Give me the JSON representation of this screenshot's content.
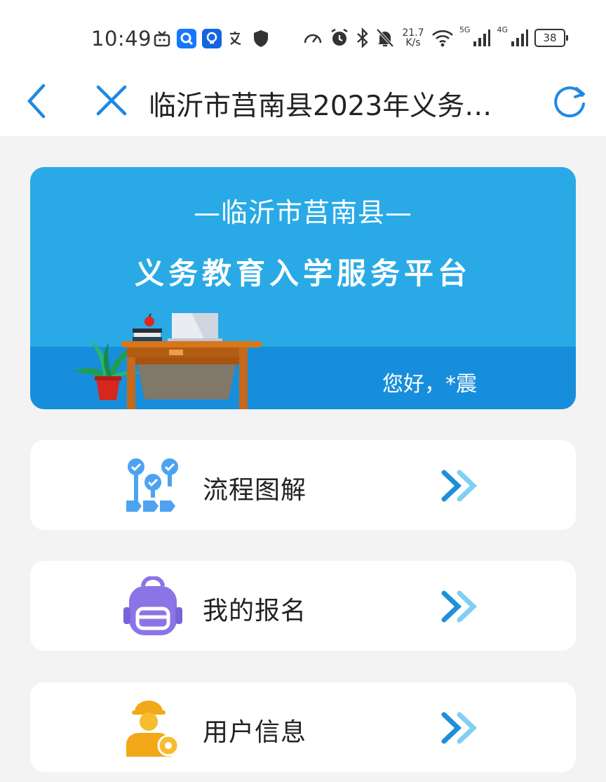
{
  "status_bar": {
    "time": "10:49",
    "speed_value": "21.7",
    "speed_unit": "K/s",
    "net1": "5G",
    "net2": "4G",
    "battery": "38"
  },
  "nav": {
    "title": "临沂市莒南县2023年义务…",
    "back_icon": "chevron-left-icon",
    "close_icon": "close-icon",
    "refresh_icon": "refresh-icon"
  },
  "banner": {
    "subtitle": "—临沂市莒南县—",
    "title": "义务教育入学服务平台",
    "greeting": "您好，*震"
  },
  "menu": [
    {
      "label": "流程图解",
      "icon": "flowchart-icon"
    },
    {
      "label": "我的报名",
      "icon": "backpack-icon"
    },
    {
      "label": "用户信息",
      "icon": "user-info-icon"
    }
  ],
  "colors": {
    "accent": "#1e88e5",
    "banner_top": "#29aae6",
    "banner_bottom": "#178edc",
    "arrow": "#1ea0e0"
  }
}
